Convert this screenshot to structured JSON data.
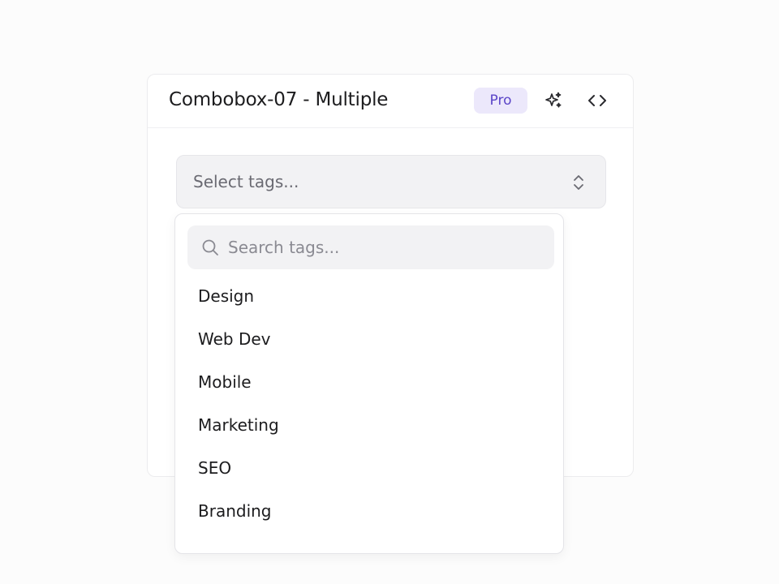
{
  "card": {
    "title": "Combobox-07 - Multiple",
    "badge": "Pro",
    "icons": [
      "sparkles-icon",
      "code-icon"
    ]
  },
  "combobox": {
    "placeholder": "Select tags...",
    "icon": "chevrons-up-down-icon"
  },
  "dropdown": {
    "search": {
      "placeholder": "Search tags...",
      "value": "",
      "icon": "search-icon"
    },
    "options": [
      "Design",
      "Web Dev",
      "Mobile",
      "Marketing",
      "SEO",
      "Branding"
    ]
  },
  "colors": {
    "badge_bg": "#ece8fb",
    "badge_text": "#5b45c8",
    "field_bg": "#f2f2f4",
    "text": "#1c1c1e",
    "muted": "#6a6a72"
  }
}
